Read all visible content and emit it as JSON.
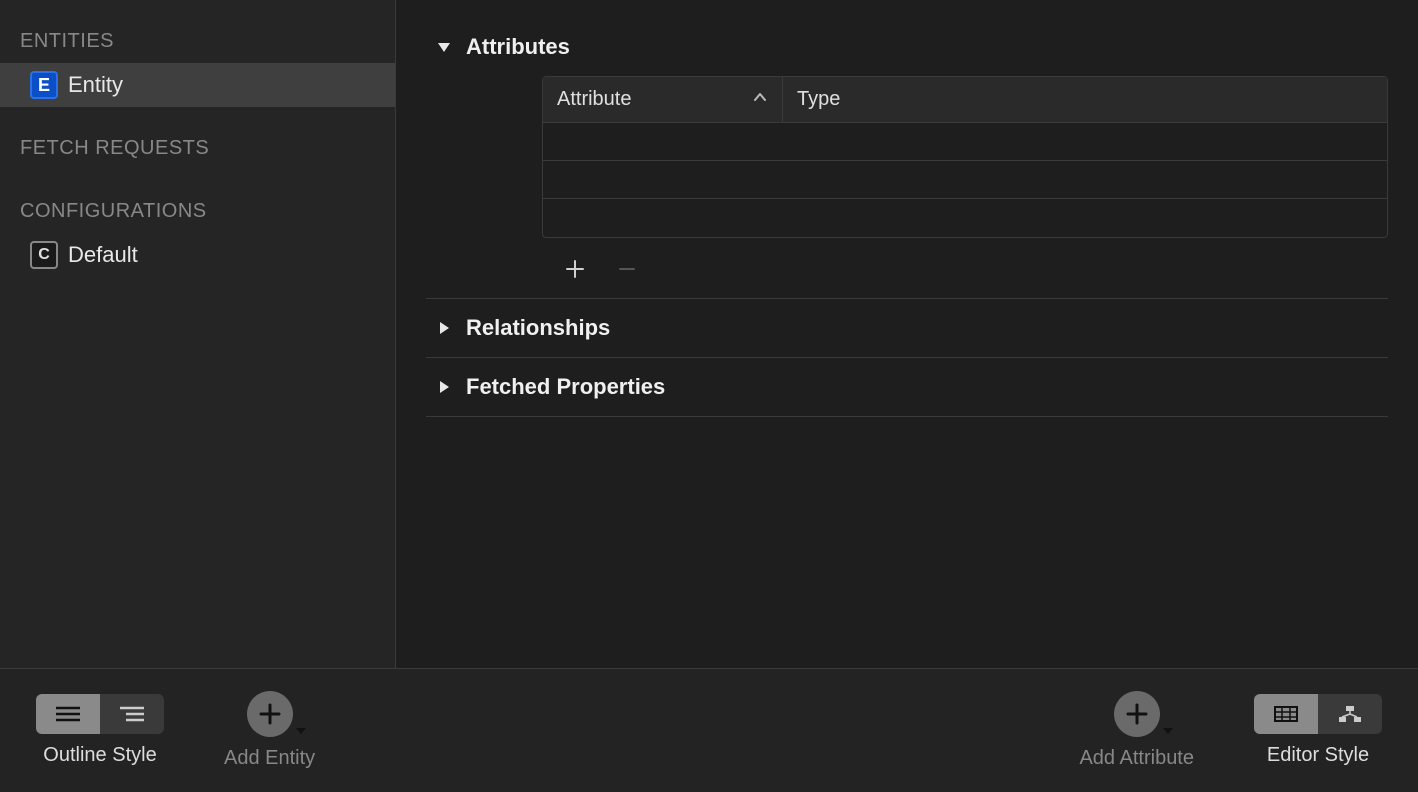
{
  "sidebar": {
    "sections": {
      "entities": {
        "heading": "ENTITIES",
        "items": [
          {
            "label": "Entity",
            "badge": "E",
            "selected": true
          }
        ]
      },
      "fetch_requests": {
        "heading": "FETCH REQUESTS",
        "items": []
      },
      "configurations": {
        "heading": "CONFIGURATIONS",
        "items": [
          {
            "label": "Default",
            "badge": "C"
          }
        ]
      }
    }
  },
  "content": {
    "attributes": {
      "title": "Attributes",
      "expanded": true,
      "columns": {
        "attribute": "Attribute",
        "type": "Type"
      },
      "rows": []
    },
    "relationships": {
      "title": "Relationships",
      "expanded": false
    },
    "fetched_properties": {
      "title": "Fetched Properties",
      "expanded": false
    }
  },
  "toolbar": {
    "outline_style": "Outline Style",
    "add_entity": "Add Entity",
    "add_attribute": "Add Attribute",
    "editor_style": "Editor Style"
  }
}
